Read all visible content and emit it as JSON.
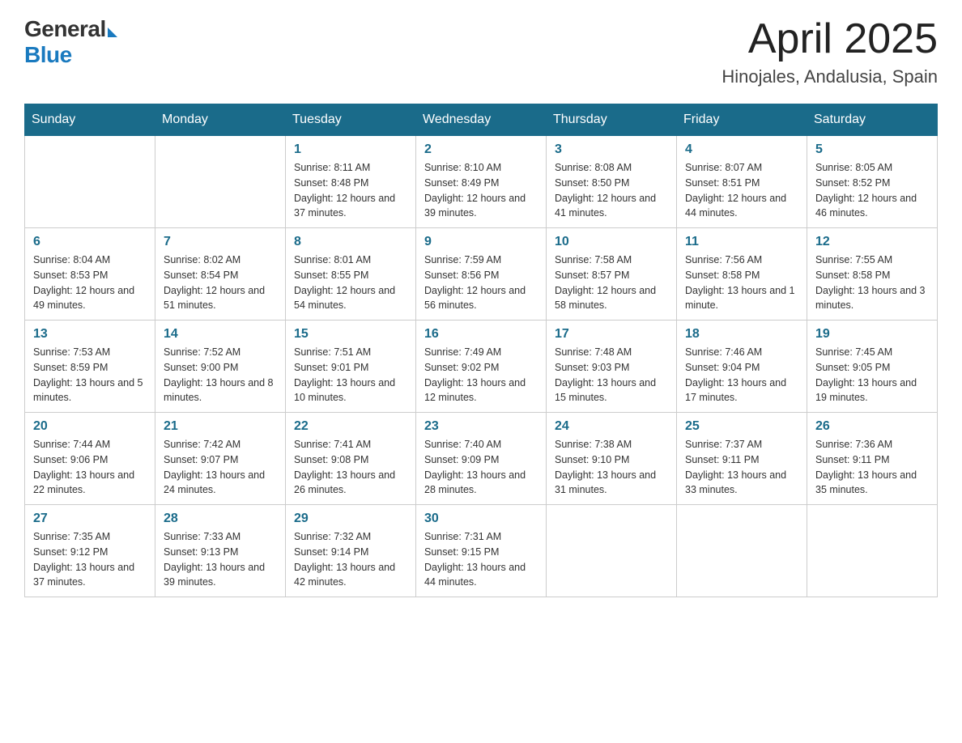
{
  "logo": {
    "general": "General",
    "blue": "Blue"
  },
  "title": {
    "month_year": "April 2025",
    "location": "Hinojales, Andalusia, Spain"
  },
  "weekdays": [
    "Sunday",
    "Monday",
    "Tuesday",
    "Wednesday",
    "Thursday",
    "Friday",
    "Saturday"
  ],
  "weeks": [
    [
      null,
      null,
      {
        "day": "1",
        "sunrise": "Sunrise: 8:11 AM",
        "sunset": "Sunset: 8:48 PM",
        "daylight": "Daylight: 12 hours and 37 minutes."
      },
      {
        "day": "2",
        "sunrise": "Sunrise: 8:10 AM",
        "sunset": "Sunset: 8:49 PM",
        "daylight": "Daylight: 12 hours and 39 minutes."
      },
      {
        "day": "3",
        "sunrise": "Sunrise: 8:08 AM",
        "sunset": "Sunset: 8:50 PM",
        "daylight": "Daylight: 12 hours and 41 minutes."
      },
      {
        "day": "4",
        "sunrise": "Sunrise: 8:07 AM",
        "sunset": "Sunset: 8:51 PM",
        "daylight": "Daylight: 12 hours and 44 minutes."
      },
      {
        "day": "5",
        "sunrise": "Sunrise: 8:05 AM",
        "sunset": "Sunset: 8:52 PM",
        "daylight": "Daylight: 12 hours and 46 minutes."
      }
    ],
    [
      {
        "day": "6",
        "sunrise": "Sunrise: 8:04 AM",
        "sunset": "Sunset: 8:53 PM",
        "daylight": "Daylight: 12 hours and 49 minutes."
      },
      {
        "day": "7",
        "sunrise": "Sunrise: 8:02 AM",
        "sunset": "Sunset: 8:54 PM",
        "daylight": "Daylight: 12 hours and 51 minutes."
      },
      {
        "day": "8",
        "sunrise": "Sunrise: 8:01 AM",
        "sunset": "Sunset: 8:55 PM",
        "daylight": "Daylight: 12 hours and 54 minutes."
      },
      {
        "day": "9",
        "sunrise": "Sunrise: 7:59 AM",
        "sunset": "Sunset: 8:56 PM",
        "daylight": "Daylight: 12 hours and 56 minutes."
      },
      {
        "day": "10",
        "sunrise": "Sunrise: 7:58 AM",
        "sunset": "Sunset: 8:57 PM",
        "daylight": "Daylight: 12 hours and 58 minutes."
      },
      {
        "day": "11",
        "sunrise": "Sunrise: 7:56 AM",
        "sunset": "Sunset: 8:58 PM",
        "daylight": "Daylight: 13 hours and 1 minute."
      },
      {
        "day": "12",
        "sunrise": "Sunrise: 7:55 AM",
        "sunset": "Sunset: 8:58 PM",
        "daylight": "Daylight: 13 hours and 3 minutes."
      }
    ],
    [
      {
        "day": "13",
        "sunrise": "Sunrise: 7:53 AM",
        "sunset": "Sunset: 8:59 PM",
        "daylight": "Daylight: 13 hours and 5 minutes."
      },
      {
        "day": "14",
        "sunrise": "Sunrise: 7:52 AM",
        "sunset": "Sunset: 9:00 PM",
        "daylight": "Daylight: 13 hours and 8 minutes."
      },
      {
        "day": "15",
        "sunrise": "Sunrise: 7:51 AM",
        "sunset": "Sunset: 9:01 PM",
        "daylight": "Daylight: 13 hours and 10 minutes."
      },
      {
        "day": "16",
        "sunrise": "Sunrise: 7:49 AM",
        "sunset": "Sunset: 9:02 PM",
        "daylight": "Daylight: 13 hours and 12 minutes."
      },
      {
        "day": "17",
        "sunrise": "Sunrise: 7:48 AM",
        "sunset": "Sunset: 9:03 PM",
        "daylight": "Daylight: 13 hours and 15 minutes."
      },
      {
        "day": "18",
        "sunrise": "Sunrise: 7:46 AM",
        "sunset": "Sunset: 9:04 PM",
        "daylight": "Daylight: 13 hours and 17 minutes."
      },
      {
        "day": "19",
        "sunrise": "Sunrise: 7:45 AM",
        "sunset": "Sunset: 9:05 PM",
        "daylight": "Daylight: 13 hours and 19 minutes."
      }
    ],
    [
      {
        "day": "20",
        "sunrise": "Sunrise: 7:44 AM",
        "sunset": "Sunset: 9:06 PM",
        "daylight": "Daylight: 13 hours and 22 minutes."
      },
      {
        "day": "21",
        "sunrise": "Sunrise: 7:42 AM",
        "sunset": "Sunset: 9:07 PM",
        "daylight": "Daylight: 13 hours and 24 minutes."
      },
      {
        "day": "22",
        "sunrise": "Sunrise: 7:41 AM",
        "sunset": "Sunset: 9:08 PM",
        "daylight": "Daylight: 13 hours and 26 minutes."
      },
      {
        "day": "23",
        "sunrise": "Sunrise: 7:40 AM",
        "sunset": "Sunset: 9:09 PM",
        "daylight": "Daylight: 13 hours and 28 minutes."
      },
      {
        "day": "24",
        "sunrise": "Sunrise: 7:38 AM",
        "sunset": "Sunset: 9:10 PM",
        "daylight": "Daylight: 13 hours and 31 minutes."
      },
      {
        "day": "25",
        "sunrise": "Sunrise: 7:37 AM",
        "sunset": "Sunset: 9:11 PM",
        "daylight": "Daylight: 13 hours and 33 minutes."
      },
      {
        "day": "26",
        "sunrise": "Sunrise: 7:36 AM",
        "sunset": "Sunset: 9:11 PM",
        "daylight": "Daylight: 13 hours and 35 minutes."
      }
    ],
    [
      {
        "day": "27",
        "sunrise": "Sunrise: 7:35 AM",
        "sunset": "Sunset: 9:12 PM",
        "daylight": "Daylight: 13 hours and 37 minutes."
      },
      {
        "day": "28",
        "sunrise": "Sunrise: 7:33 AM",
        "sunset": "Sunset: 9:13 PM",
        "daylight": "Daylight: 13 hours and 39 minutes."
      },
      {
        "day": "29",
        "sunrise": "Sunrise: 7:32 AM",
        "sunset": "Sunset: 9:14 PM",
        "daylight": "Daylight: 13 hours and 42 minutes."
      },
      {
        "day": "30",
        "sunrise": "Sunrise: 7:31 AM",
        "sunset": "Sunset: 9:15 PM",
        "daylight": "Daylight: 13 hours and 44 minutes."
      },
      null,
      null,
      null
    ]
  ]
}
